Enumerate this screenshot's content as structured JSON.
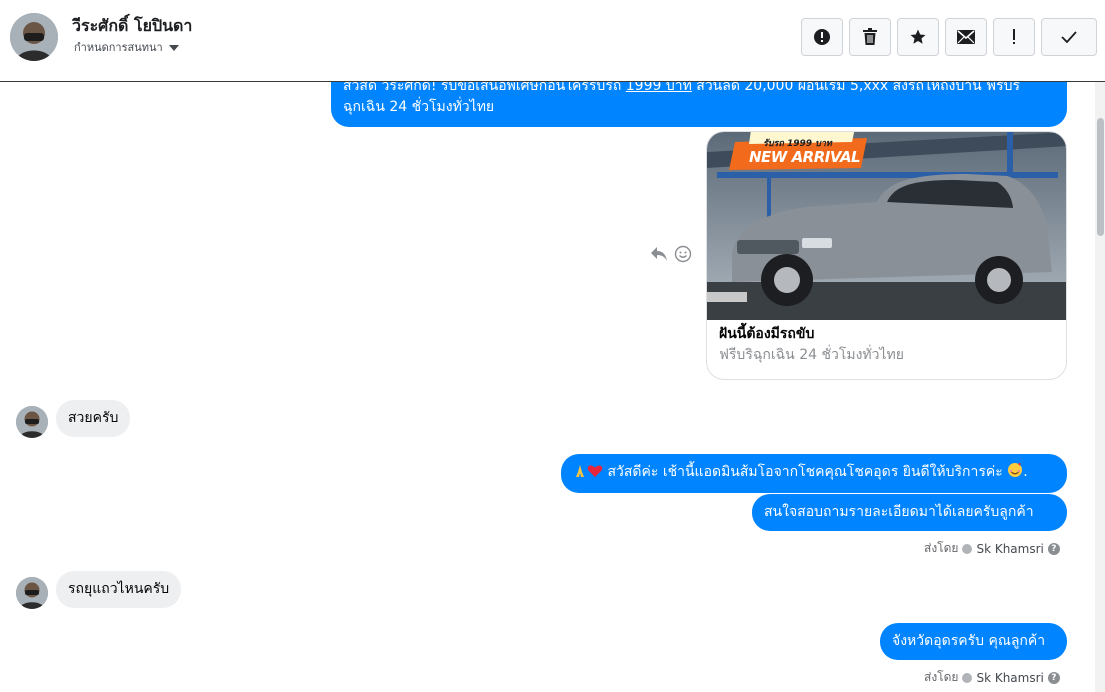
{
  "header": {
    "contact_name": "วีระศักดิ์ โยปินดา",
    "nickname_label": "กำหนดการสนทนา",
    "buttons": [
      "alert-circle-icon",
      "trash-icon",
      "star-icon",
      "envelope-icon",
      "exclamation-icon",
      "check-icon"
    ]
  },
  "messages": {
    "promo_line1_a": "สวัสดี วีระศักดิ์! รับข้อเสนอพิเศษก่อนใครรับรถ ",
    "promo_price": "1999 บาท",
    "promo_line1_b": " ส่วนลด 20,000 ผ่อนเริ่ม 5,xxx ส่งรถให้ถึงบ้าน ฟรีบริ",
    "promo_line2": "ฉุกเฉิน 24 ชั่วโมงทั่วไทย",
    "card": {
      "banner_top": "รับรถ 1999 บาท",
      "banner_main": "NEW ARRIVAL",
      "title": "ฝันนี้ต้องมีรถขับ",
      "description": "ฟรีบริฉุกเฉิน 24 ชั่วโมงทั่วไทย"
    },
    "in_1": "สวยครับ",
    "out_1": "สวัสดีค่ะ เช้านี้แอดมินส้มโอจากโชคคุณโชคอุดร ยินดีให้บริการค่ะ",
    "out_2": "สนใจสอบถามรายละเอียดมาได้เลยครับลูกค้า",
    "sent_by_label": "ส่งโดย",
    "sent_by_name": "Sk Khamsri",
    "in_2": "รถยุแถวไหนครับ",
    "out_3": "จังหวัดอุดรครับ คุณลูกค้า",
    "sent_by_label_2": "ส่งโดย",
    "sent_by_name_2": "Sk Khamsri"
  },
  "colors": {
    "outgoing_bubble": "#0084ff",
    "incoming_bubble": "#eeeff1",
    "banner_orange": "#f26a1b"
  }
}
